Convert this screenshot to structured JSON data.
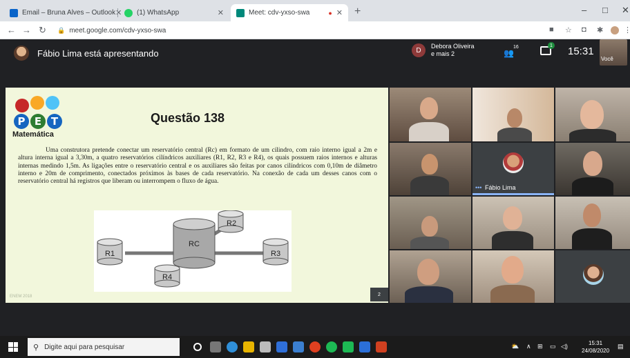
{
  "browser": {
    "tabs": [
      {
        "label": "Email – Bruna Alves – Outlook",
        "icon": "outlook-icon",
        "color": "#0a64c9"
      },
      {
        "label": "(1) WhatsApp",
        "icon": "whatsapp-icon",
        "color": "#25d366"
      },
      {
        "label": "Meet: cdv-yxso-swa",
        "icon": "meet-icon",
        "color": "#00897b",
        "active": true
      }
    ],
    "new_tab": "+",
    "window_controls": [
      "–",
      "□",
      "✕"
    ],
    "url": "meet.google.com/cdv-yxso-swa"
  },
  "meet": {
    "presenter_text": "Fábio Lima está apresentando",
    "participant_chip": {
      "initial": "D",
      "line1": "Debora Oliveira",
      "line2": "e mais 2"
    },
    "people_count": "16",
    "chat_badge": "1",
    "time": "15:31",
    "self_label": "Você",
    "presenter_tile_name": "Fábio Lima",
    "presenter_tile_dots": "•••"
  },
  "slide": {
    "logo_letters": [
      "P",
      "E",
      "T"
    ],
    "logo_word": "Matemática",
    "title": "Questão 138",
    "paragraph": "Uma construtora pretende conectar um reservatório central (Rc) em formato de um cilindro, com raio interno igual a 2m e altura interna igual a 3,30m, a quatro reservatórios cilíndricos auxiliares (R1, R2, R3 e R4), os quais possuem raios internos e alturas internas medindo 1,5m. As ligações entre o reservatório central e os auxiliares são feitas por canos cilíndricos com 0,10m de diâmetro interno e 20m de comprimento, conectados próximos às bases de cada reservatório. Na conexão de cada um desses canos com o reservatório central há registros que liberam ou interrompem o fluxo de água.",
    "diagram_labels": {
      "rc": "RC",
      "r1": "R1",
      "r2": "R2",
      "r3": "R3",
      "r4": "R4"
    },
    "page_number": "2",
    "footer_text": "ENEM 2018"
  },
  "taskbar": {
    "search_placeholder": "Digite aqui para pesquisar",
    "time": "15:31",
    "date": "24/08/2020"
  }
}
